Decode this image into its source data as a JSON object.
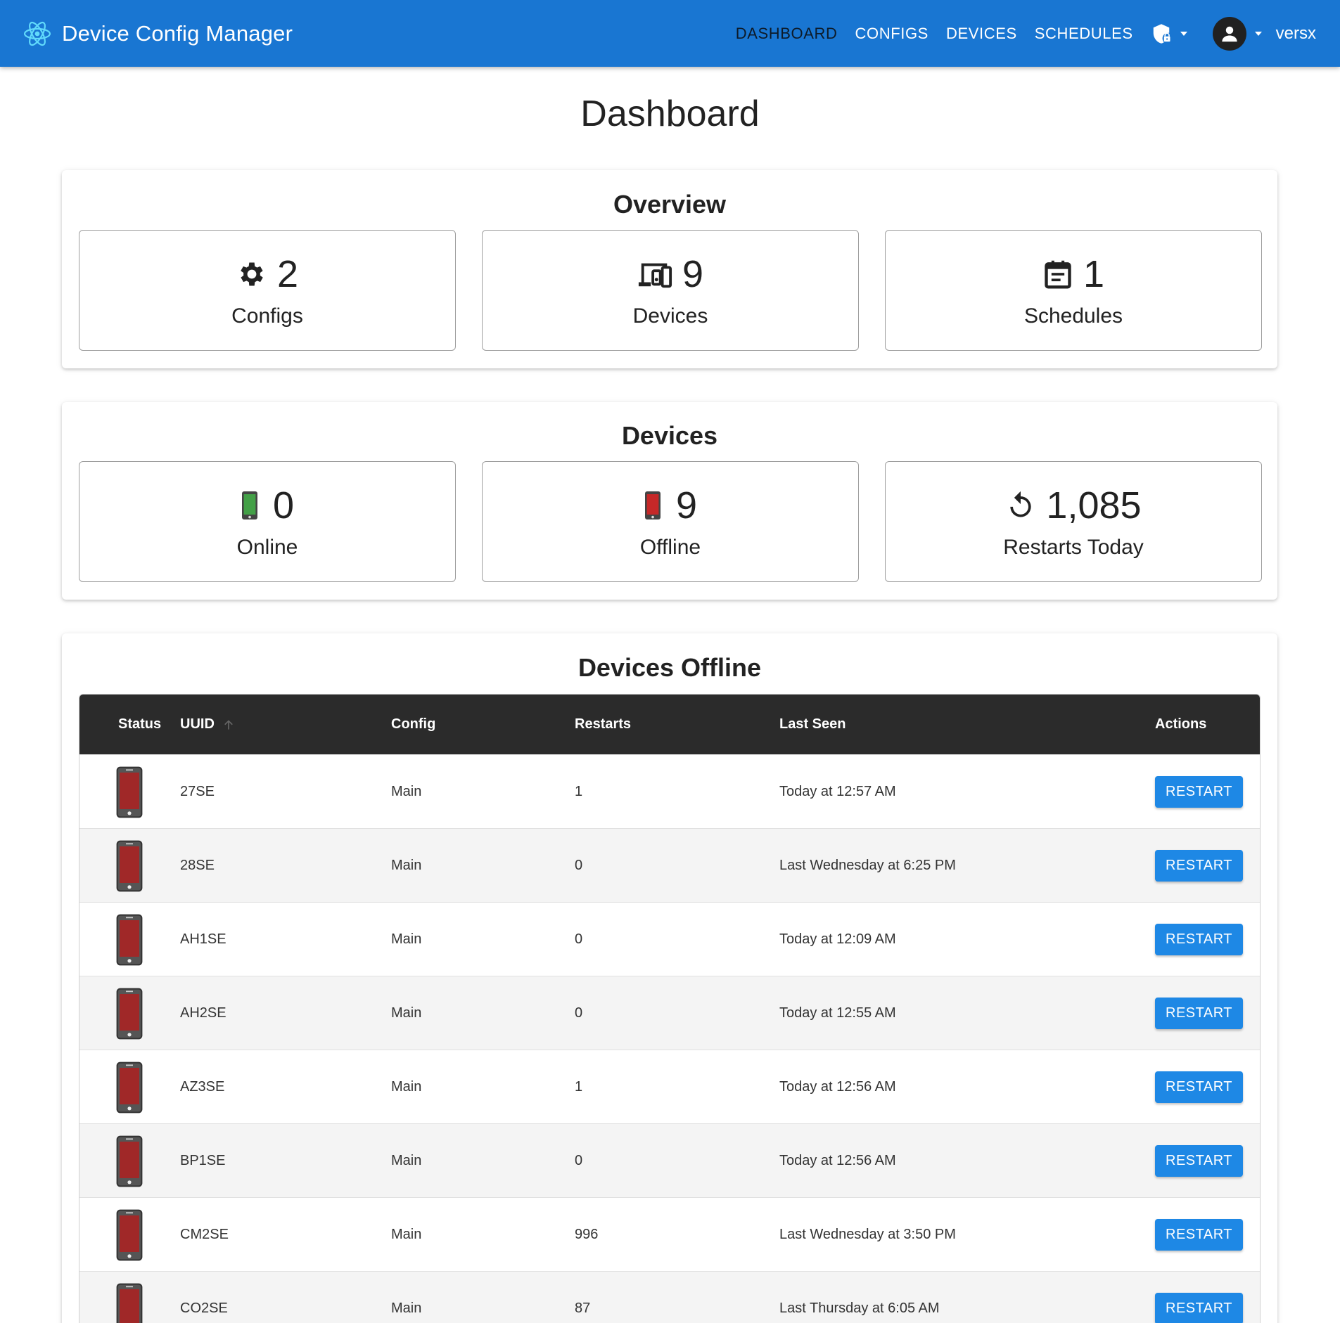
{
  "app": {
    "title": "Device Config Manager",
    "nav": [
      "DASHBOARD",
      "CONFIGS",
      "DEVICES",
      "SCHEDULES"
    ],
    "active_nav": "DASHBOARD",
    "username": "versx",
    "icons": [
      "react-atom-icon",
      "shield-lock-icon",
      "account-circle-icon"
    ],
    "colors": {
      "appbar": "#1976d2",
      "button": "#1e88e5",
      "online": "#43a047",
      "offline": "#a02828"
    }
  },
  "page": {
    "title": "Dashboard"
  },
  "overview": {
    "title": "Overview",
    "cards": [
      {
        "icon": "gear-icon",
        "value": "2",
        "label": "Configs"
      },
      {
        "icon": "devices-icon",
        "value": "9",
        "label": "Devices"
      },
      {
        "icon": "calendar-icon",
        "value": "1",
        "label": "Schedules"
      }
    ]
  },
  "devices_summary": {
    "title": "Devices",
    "cards": [
      {
        "icon": "phone-online-icon",
        "value": "0",
        "label": "Online"
      },
      {
        "icon": "phone-offline-icon",
        "value": "9",
        "label": "Offline"
      },
      {
        "icon": "restart-icon",
        "value": "1,085",
        "label": "Restarts Today"
      }
    ]
  },
  "offline_table": {
    "title": "Devices Offline",
    "columns": [
      "Status",
      "UUID",
      "Config",
      "Restarts",
      "Last Seen",
      "Actions"
    ],
    "sort_column": "UUID",
    "sort_direction": "ascending",
    "action_label": "RESTART",
    "rows": [
      {
        "status": "offline",
        "uuid": "27SE",
        "config": "Main",
        "restarts": "1",
        "last_seen": "Today at 12:57 AM"
      },
      {
        "status": "offline",
        "uuid": "28SE",
        "config": "Main",
        "restarts": "0",
        "last_seen": "Last Wednesday at 6:25 PM"
      },
      {
        "status": "offline",
        "uuid": "AH1SE",
        "config": "Main",
        "restarts": "0",
        "last_seen": "Today at 12:09 AM"
      },
      {
        "status": "offline",
        "uuid": "AH2SE",
        "config": "Main",
        "restarts": "0",
        "last_seen": "Today at 12:55 AM"
      },
      {
        "status": "offline",
        "uuid": "AZ3SE",
        "config": "Main",
        "restarts": "1",
        "last_seen": "Today at 12:56 AM"
      },
      {
        "status": "offline",
        "uuid": "BP1SE",
        "config": "Main",
        "restarts": "0",
        "last_seen": "Today at 12:56 AM"
      },
      {
        "status": "offline",
        "uuid": "CM2SE",
        "config": "Main",
        "restarts": "996",
        "last_seen": "Last Wednesday at 3:50 PM"
      },
      {
        "status": "offline",
        "uuid": "CO2SE",
        "config": "Main",
        "restarts": "87",
        "last_seen": "Last Thursday at 6:05 AM"
      }
    ]
  }
}
